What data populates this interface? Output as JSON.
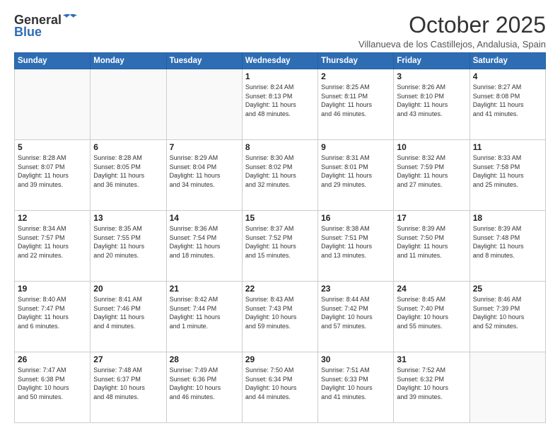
{
  "header": {
    "logo_general": "General",
    "logo_blue": "Blue",
    "month_title": "October 2025",
    "subtitle": "Villanueva de los Castillejos, Andalusia, Spain"
  },
  "days_of_week": [
    "Sunday",
    "Monday",
    "Tuesday",
    "Wednesday",
    "Thursday",
    "Friday",
    "Saturday"
  ],
  "weeks": [
    {
      "days": [
        {
          "num": "",
          "info": ""
        },
        {
          "num": "",
          "info": ""
        },
        {
          "num": "",
          "info": ""
        },
        {
          "num": "1",
          "info": "Sunrise: 8:24 AM\nSunset: 8:13 PM\nDaylight: 11 hours\nand 48 minutes."
        },
        {
          "num": "2",
          "info": "Sunrise: 8:25 AM\nSunset: 8:11 PM\nDaylight: 11 hours\nand 46 minutes."
        },
        {
          "num": "3",
          "info": "Sunrise: 8:26 AM\nSunset: 8:10 PM\nDaylight: 11 hours\nand 43 minutes."
        },
        {
          "num": "4",
          "info": "Sunrise: 8:27 AM\nSunset: 8:08 PM\nDaylight: 11 hours\nand 41 minutes."
        }
      ]
    },
    {
      "days": [
        {
          "num": "5",
          "info": "Sunrise: 8:28 AM\nSunset: 8:07 PM\nDaylight: 11 hours\nand 39 minutes."
        },
        {
          "num": "6",
          "info": "Sunrise: 8:28 AM\nSunset: 8:05 PM\nDaylight: 11 hours\nand 36 minutes."
        },
        {
          "num": "7",
          "info": "Sunrise: 8:29 AM\nSunset: 8:04 PM\nDaylight: 11 hours\nand 34 minutes."
        },
        {
          "num": "8",
          "info": "Sunrise: 8:30 AM\nSunset: 8:02 PM\nDaylight: 11 hours\nand 32 minutes."
        },
        {
          "num": "9",
          "info": "Sunrise: 8:31 AM\nSunset: 8:01 PM\nDaylight: 11 hours\nand 29 minutes."
        },
        {
          "num": "10",
          "info": "Sunrise: 8:32 AM\nSunset: 7:59 PM\nDaylight: 11 hours\nand 27 minutes."
        },
        {
          "num": "11",
          "info": "Sunrise: 8:33 AM\nSunset: 7:58 PM\nDaylight: 11 hours\nand 25 minutes."
        }
      ]
    },
    {
      "days": [
        {
          "num": "12",
          "info": "Sunrise: 8:34 AM\nSunset: 7:57 PM\nDaylight: 11 hours\nand 22 minutes."
        },
        {
          "num": "13",
          "info": "Sunrise: 8:35 AM\nSunset: 7:55 PM\nDaylight: 11 hours\nand 20 minutes."
        },
        {
          "num": "14",
          "info": "Sunrise: 8:36 AM\nSunset: 7:54 PM\nDaylight: 11 hours\nand 18 minutes."
        },
        {
          "num": "15",
          "info": "Sunrise: 8:37 AM\nSunset: 7:52 PM\nDaylight: 11 hours\nand 15 minutes."
        },
        {
          "num": "16",
          "info": "Sunrise: 8:38 AM\nSunset: 7:51 PM\nDaylight: 11 hours\nand 13 minutes."
        },
        {
          "num": "17",
          "info": "Sunrise: 8:39 AM\nSunset: 7:50 PM\nDaylight: 11 hours\nand 11 minutes."
        },
        {
          "num": "18",
          "info": "Sunrise: 8:39 AM\nSunset: 7:48 PM\nDaylight: 11 hours\nand 8 minutes."
        }
      ]
    },
    {
      "days": [
        {
          "num": "19",
          "info": "Sunrise: 8:40 AM\nSunset: 7:47 PM\nDaylight: 11 hours\nand 6 minutes."
        },
        {
          "num": "20",
          "info": "Sunrise: 8:41 AM\nSunset: 7:46 PM\nDaylight: 11 hours\nand 4 minutes."
        },
        {
          "num": "21",
          "info": "Sunrise: 8:42 AM\nSunset: 7:44 PM\nDaylight: 11 hours\nand 1 minute."
        },
        {
          "num": "22",
          "info": "Sunrise: 8:43 AM\nSunset: 7:43 PM\nDaylight: 10 hours\nand 59 minutes."
        },
        {
          "num": "23",
          "info": "Sunrise: 8:44 AM\nSunset: 7:42 PM\nDaylight: 10 hours\nand 57 minutes."
        },
        {
          "num": "24",
          "info": "Sunrise: 8:45 AM\nSunset: 7:40 PM\nDaylight: 10 hours\nand 55 minutes."
        },
        {
          "num": "25",
          "info": "Sunrise: 8:46 AM\nSunset: 7:39 PM\nDaylight: 10 hours\nand 52 minutes."
        }
      ]
    },
    {
      "days": [
        {
          "num": "26",
          "info": "Sunrise: 7:47 AM\nSunset: 6:38 PM\nDaylight: 10 hours\nand 50 minutes."
        },
        {
          "num": "27",
          "info": "Sunrise: 7:48 AM\nSunset: 6:37 PM\nDaylight: 10 hours\nand 48 minutes."
        },
        {
          "num": "28",
          "info": "Sunrise: 7:49 AM\nSunset: 6:36 PM\nDaylight: 10 hours\nand 46 minutes."
        },
        {
          "num": "29",
          "info": "Sunrise: 7:50 AM\nSunset: 6:34 PM\nDaylight: 10 hours\nand 44 minutes."
        },
        {
          "num": "30",
          "info": "Sunrise: 7:51 AM\nSunset: 6:33 PM\nDaylight: 10 hours\nand 41 minutes."
        },
        {
          "num": "31",
          "info": "Sunrise: 7:52 AM\nSunset: 6:32 PM\nDaylight: 10 hours\nand 39 minutes."
        },
        {
          "num": "",
          "info": ""
        }
      ]
    }
  ]
}
